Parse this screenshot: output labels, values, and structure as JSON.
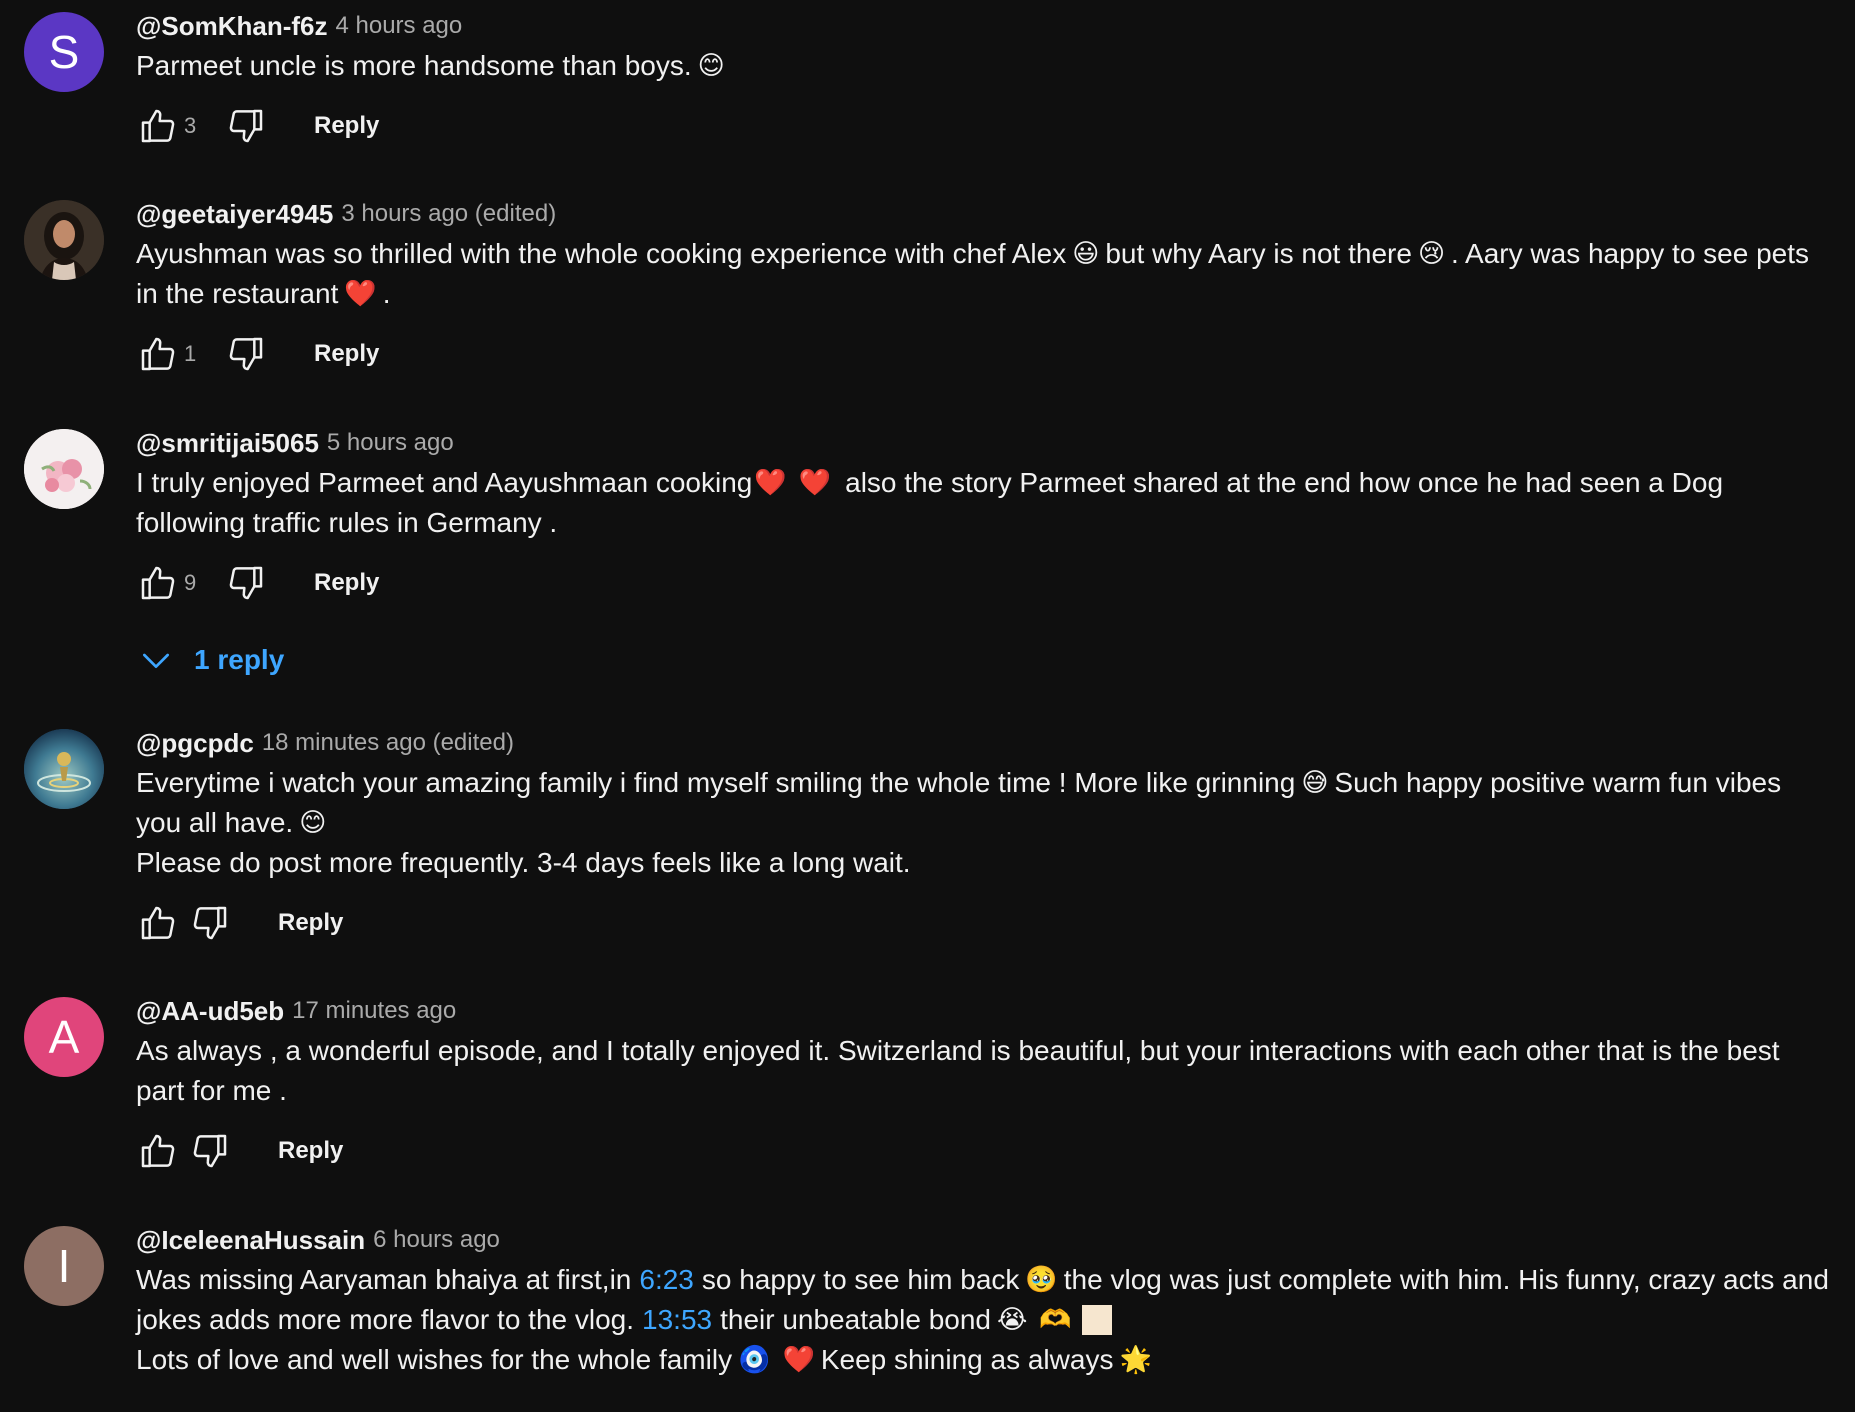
{
  "comments": [
    {
      "author": "@SomKhan-f6z",
      "time": "4 hours ago",
      "avatar_letter": "S",
      "avatar_color": "#5b37c4",
      "lines": [
        "Parmeet uncle is more handsome than boys."
      ],
      "emojis": [
        "😊"
      ],
      "likes": "3",
      "reply_label": "Reply"
    },
    {
      "author": "@geetaiyer4945",
      "time": "3 hours ago (edited)",
      "avatar_icon": "woman-photo",
      "lines_parts": [
        [
          "Ayushman was so thrilled with the whole cooking experience with chef Alex",
          "but why Aary is not there",
          ". Aary was happy to see pets"
        ],
        [
          "in the restaurant",
          "."
        ]
      ],
      "emojis": [
        "😃",
        "😢",
        "❤️"
      ],
      "likes": "1",
      "reply_label": "Reply"
    },
    {
      "author": "@smritijai5065",
      "time": "5 hours ago",
      "avatar_icon": "flowers-photo",
      "lines_parts": [
        [
          "I truly enjoyed Parmeet and Aayushmaan cooking",
          "also the  story Parmeet shared at the end how once he had seen  a Dog"
        ],
        [
          "following traffic rules in Germany ."
        ]
      ],
      "emojis": [
        "❤️",
        "❤️"
      ],
      "likes": "9",
      "reply_label": "Reply",
      "replies_label": "1 reply"
    },
    {
      "author": "@pgcpdc",
      "time": "18 minutes ago (edited)",
      "avatar_icon": "water-drop-photo",
      "lines_parts": [
        [
          "Everytime i watch your amazing family i find myself smiling the whole time ! More like grinning",
          "Such happy positive warm fun vibes"
        ],
        [
          "you all have."
        ],
        [
          "Please do post more frequently. 3-4 days feels like a long wait."
        ]
      ],
      "emojis": [
        "😅",
        "😊"
      ],
      "likes": "",
      "reply_label": "Reply"
    },
    {
      "author": "@AA-ud5eb",
      "time": "17 minutes ago",
      "avatar_letter": "A",
      "avatar_color": "#e0457b",
      "lines_parts": [
        [
          "As always , a wonderful episode, and I totally enjoyed it.  Switzerland is beautiful, but  your interactions with each other that is the best"
        ],
        [
          "part for me ."
        ]
      ],
      "likes": "",
      "reply_label": "Reply"
    },
    {
      "author": "@IceleenaHussain",
      "time": "6 hours ago",
      "avatar_letter": "I",
      "avatar_color": "#8d6e63",
      "lines_parts": [
        [
          "Was missing Aaryaman bhaiya at first,in",
          "6:23",
          "so happy to see him back",
          "the vlog was just complete with him. His funny, crazy acts and"
        ],
        [
          "jokes adds more more flavor to the vlog.",
          "13:53",
          "their unbeatable bond"
        ],
        [
          "Lots of love and well wishes for the whole family",
          "Keep shining as always"
        ]
      ],
      "emojis": [
        "🥹",
        "😭",
        "🫶",
        "🧿",
        "❤️",
        "🌟"
      ],
      "likes": "",
      "reply_label": "Reply"
    }
  ]
}
